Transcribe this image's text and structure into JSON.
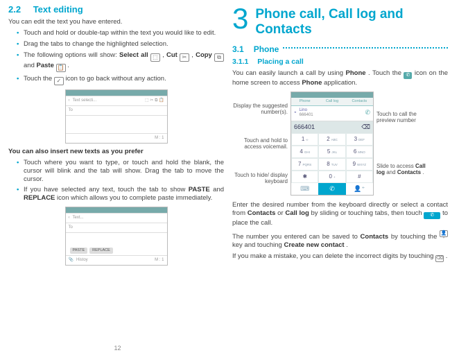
{
  "left": {
    "sec_num": "2.2",
    "sec_title": "Text editing",
    "intro": "You can edit the text you have entered.",
    "bullets1": {
      "b1": "Touch and hold or double-tap within the text you would like to edit.",
      "b2": "Drag the tabs to change the highlighted selection.",
      "b3_pre": "The following options will show: ",
      "b3_sa": "Select all",
      "b3_cut": "Cut",
      "b3_copy": "Copy",
      "b3_and": " and ",
      "b3_paste": "Paste",
      "b4_pre": "Touch the ",
      "b4_post": " icon to go back without any action."
    },
    "screenshot1": {
      "t1": "Text selecti...",
      "t2": "To"
    },
    "insert_head": "You can also insert new texts as you prefer",
    "bullets2": {
      "b1": "Touch where you want to type, or touch and hold the blank, the cursor will blink and the tab will show. Drag the tab to move the cursor.",
      "b2_pre": "If you have selected any text, touch the tab to show ",
      "b2_p": "PASTE",
      "b2_and": " and ",
      "b2_r": "REPLACE",
      "b2_post": " icon which allows you to complete paste immediately."
    },
    "screenshot2": {
      "t1": "Text...",
      "t2": "To",
      "btn1": "PASTE",
      "btn2": "REPLACE",
      "t3": "Histoy"
    },
    "page_num": "12"
  },
  "right": {
    "chapter_num": "3",
    "chapter_title": "Phone call, Call log and Contacts",
    "s31_num": "3.1",
    "s31_title": "Phone",
    "s311_num": "3.1.1",
    "s311_title": "Placing a call",
    "p1_pre": "You can easily launch a call by using ",
    "p1_phone": "Phone",
    "p1_mid": ". Touch the ",
    "p1_post": " icon on the home screen to access ",
    "p1_app": "Phone",
    "p1_end": " application.",
    "labelsL": {
      "l1": "Display the suggested number(s).",
      "l2": "Touch and hold to access voicemail.",
      "l3": "Touch to hide/ display keyboard"
    },
    "labelsR": {
      "r1": "Touch to call the preview number",
      "r2_pre": "Slide to access ",
      "r2_b1": "Call log",
      "r2_mid": " and ",
      "r2_b2": "Contacts",
      "r2_end": "."
    },
    "dialer": {
      "tab1": "Phone",
      "tab2": "Call log",
      "tab3": "Contacts",
      "sug_name": "Lino",
      "sug_num": "666401",
      "field": "666401",
      "keys": [
        "1",
        "2 ABC",
        "3 DEF",
        "4 GHI",
        "5 JKL",
        "6 MNO",
        "7 PQRS",
        "8 TUV",
        "9 WXYZ",
        "*",
        "0 +",
        "#"
      ]
    },
    "p2_pre": "Enter the desired number from the keyboard directly or select a contact from ",
    "p2_c": "Contacts",
    "p2_or": " or ",
    "p2_cl": "Call log",
    "p2_mid": " by sliding or touching tabs, then touch ",
    "p2_end": " to place the call.",
    "p3_pre": "The number you entered can be saved to ",
    "p3_c": "Contacts",
    "p3_mid": " by touching the ",
    "p3_mid2": " key and touching ",
    "p3_cnc": "Create new contact",
    "p3_end": ".",
    "p4_pre": "If you make a mistake, you can delete the incorrect digits by touching ",
    "p4_end": "."
  }
}
